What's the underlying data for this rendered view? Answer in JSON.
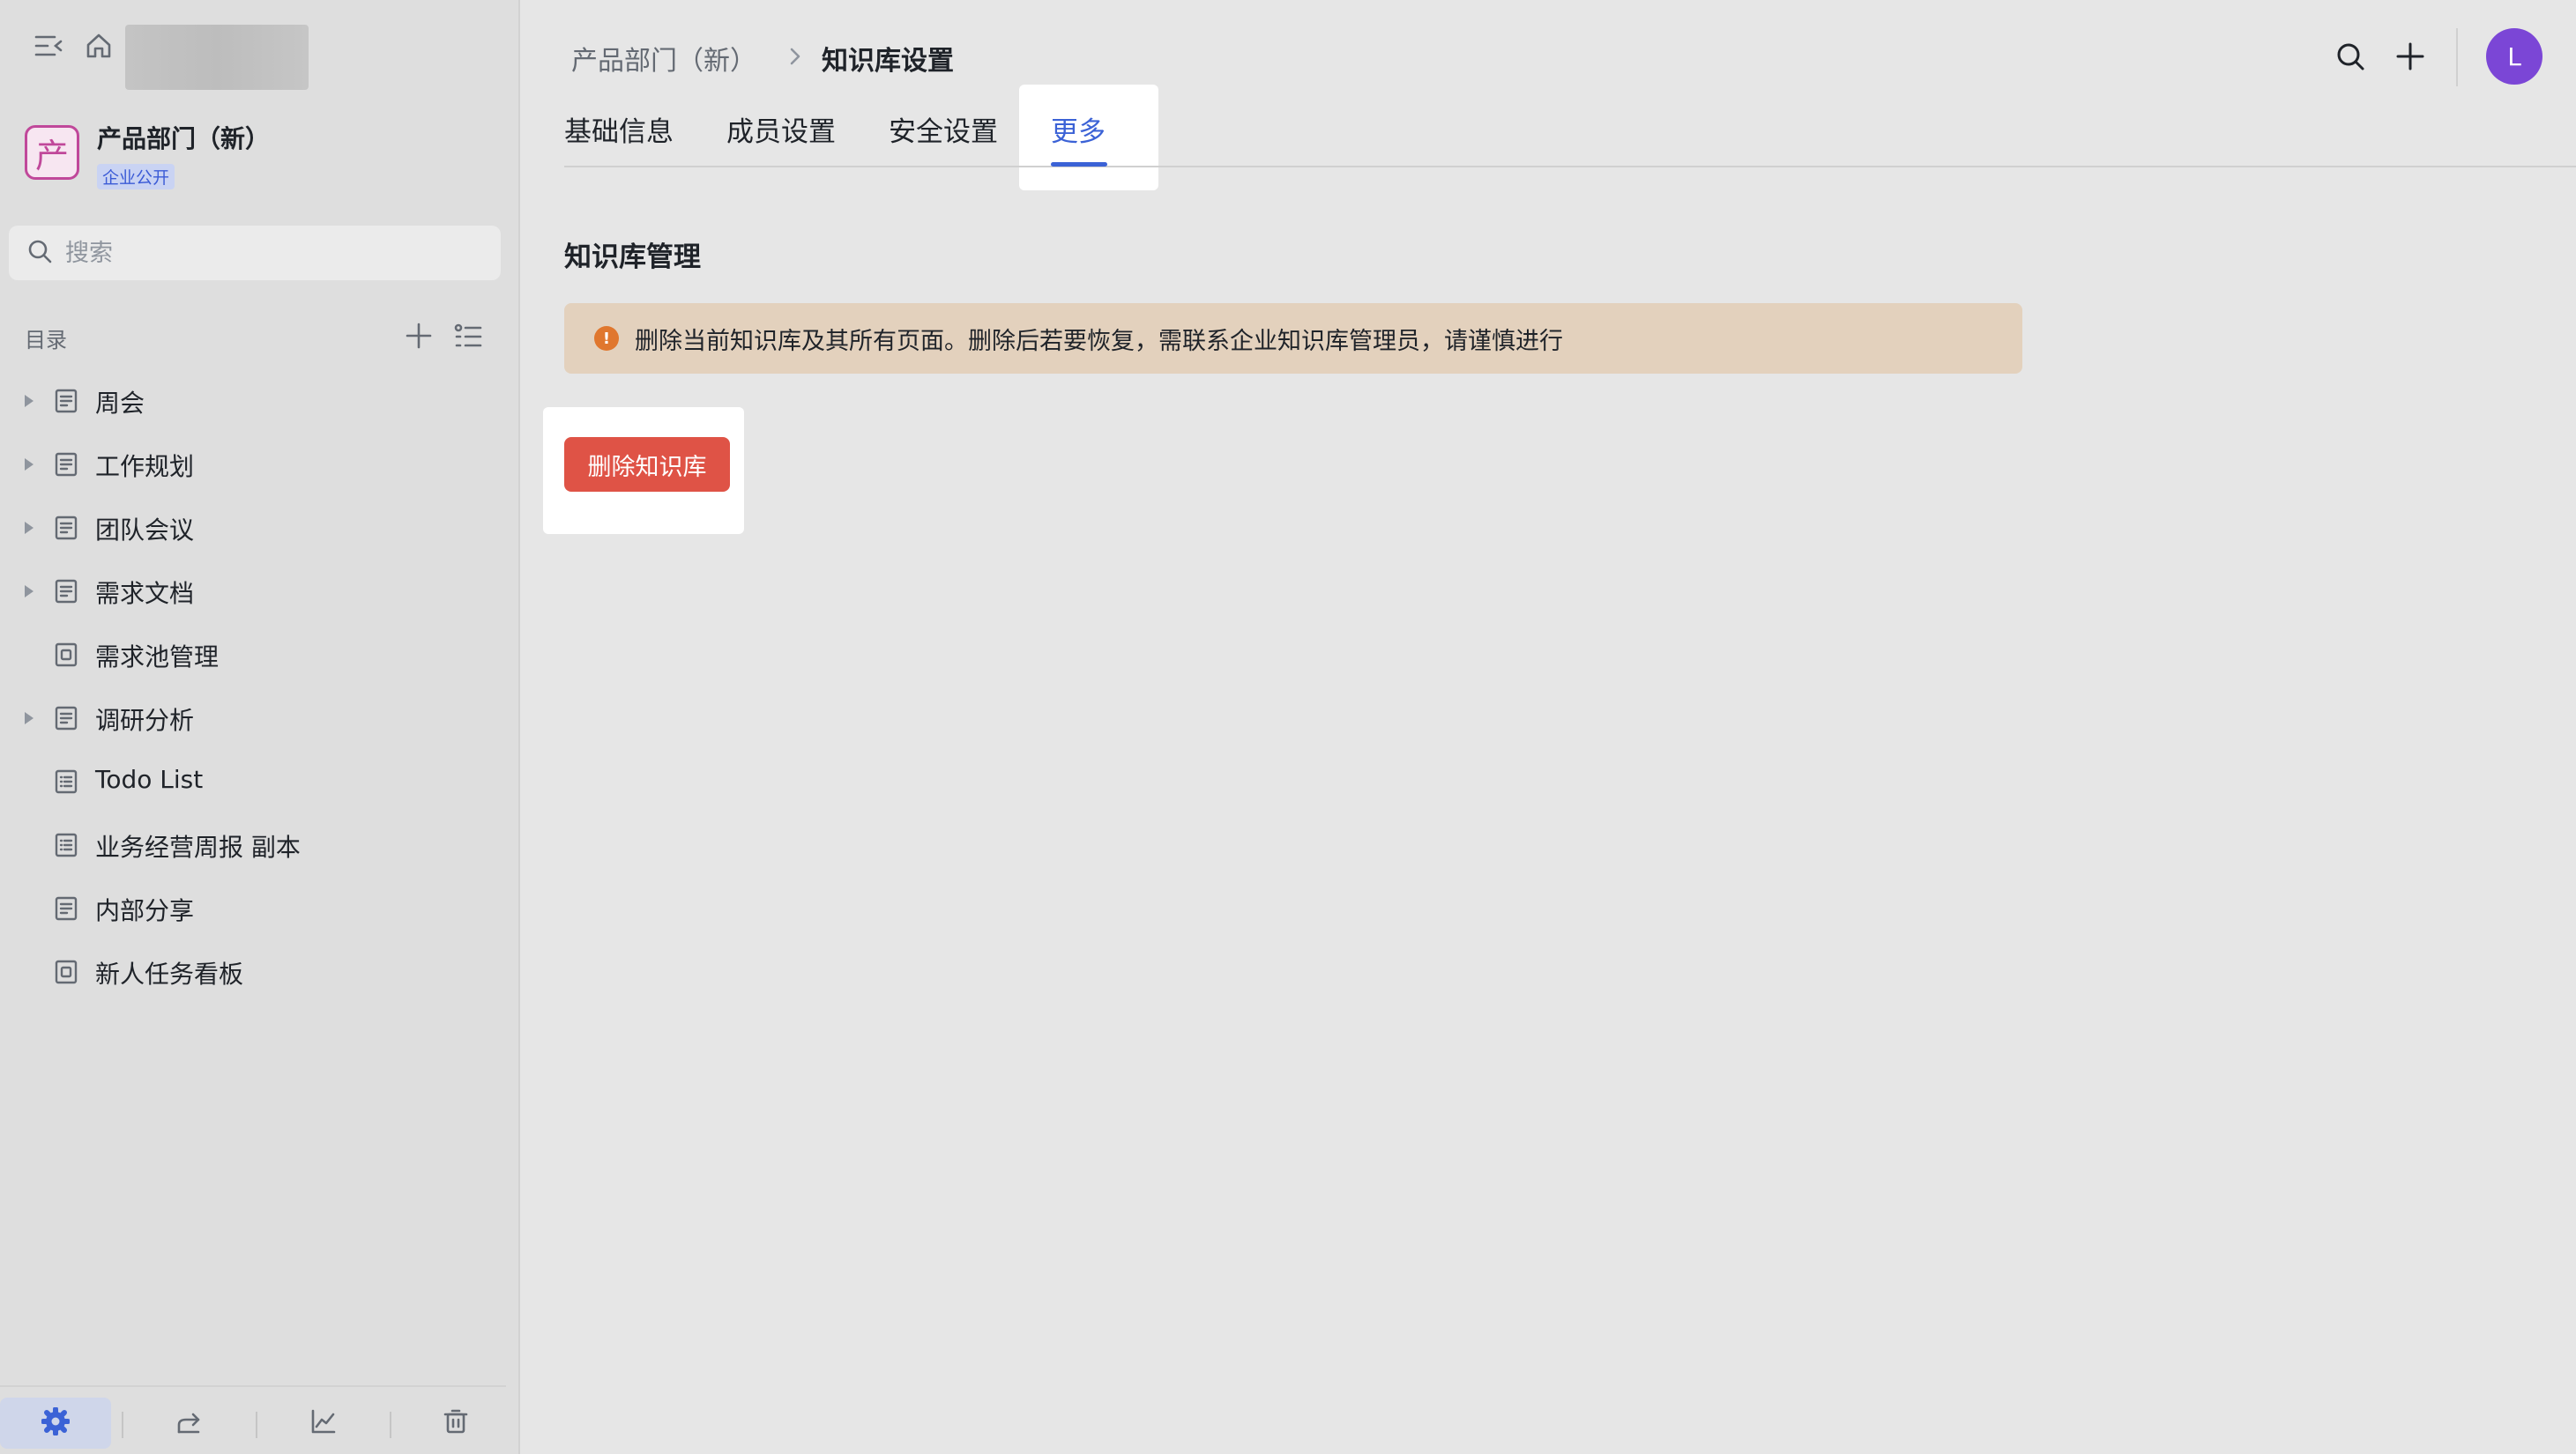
{
  "sidebar": {
    "space": {
      "logo_char": "产",
      "name": "产品部门（新）",
      "badge": "企业公开",
      "logo_color": "#c0489a"
    },
    "search": {
      "placeholder": "搜索",
      "value": ""
    },
    "toc": {
      "title": "目录",
      "items": [
        {
          "label": "周会",
          "expandable": true,
          "icon": "doc-icon"
        },
        {
          "label": "工作规划",
          "expandable": true,
          "icon": "doc-icon"
        },
        {
          "label": "团队会议",
          "expandable": true,
          "icon": "doc-icon"
        },
        {
          "label": "需求文档",
          "expandable": true,
          "icon": "doc-icon"
        },
        {
          "label": "需求池管理",
          "expandable": false,
          "icon": "board-icon"
        },
        {
          "label": "调研分析",
          "expandable": true,
          "icon": "doc-icon"
        },
        {
          "label": "Todo List",
          "expandable": false,
          "icon": "checklist-icon"
        },
        {
          "label": "业务经营周报 副本",
          "expandable": false,
          "icon": "checklist-icon"
        },
        {
          "label": "内部分享",
          "expandable": false,
          "icon": "doc-icon"
        },
        {
          "label": "新人任务看板",
          "expandable": false,
          "icon": "board-icon"
        }
      ]
    },
    "bottom_icons": [
      "settings-icon",
      "share-icon",
      "analytics-icon",
      "trash-icon"
    ]
  },
  "header": {
    "breadcrumb_parent": "产品部门（新）",
    "breadcrumb_current": "知识库设置",
    "avatar_initial": "L",
    "avatar_color": "#7b46d6"
  },
  "tabs": [
    {
      "label": "基础信息",
      "active": false
    },
    {
      "label": "成员设置",
      "active": false
    },
    {
      "label": "安全设置",
      "active": false
    },
    {
      "label": "更多",
      "active": true
    }
  ],
  "main": {
    "section_title": "知识库管理",
    "warning_icon": "!",
    "warning_text": "删除当前知识库及其所有页面。删除后若要恢复，需联系企业知识库管理员，请谨慎进行",
    "delete_label": "删除知识库",
    "delete_color": "#df5346",
    "accent_color": "#3b62d6"
  }
}
